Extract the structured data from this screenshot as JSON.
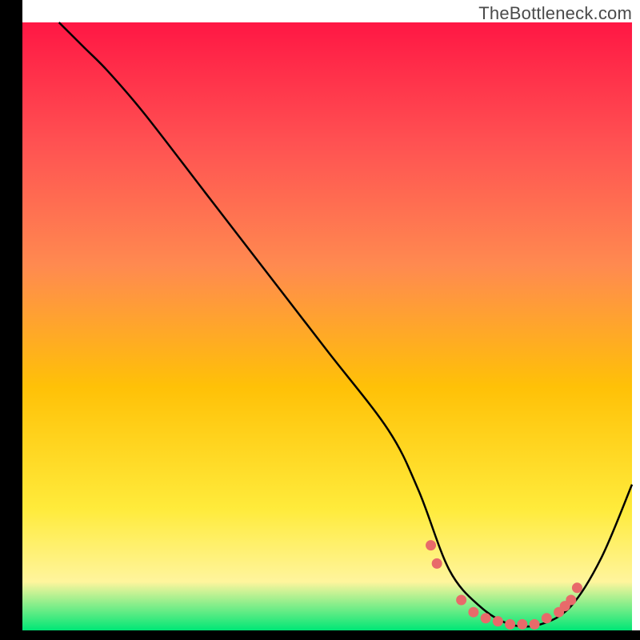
{
  "watermark": "TheBottleneck.com",
  "chart_data": {
    "type": "line",
    "title": "",
    "xlabel": "",
    "ylabel": "",
    "xlim": [
      0,
      100
    ],
    "ylim": [
      0,
      100
    ],
    "series": [
      {
        "name": "bottleneck-curve",
        "x": [
          6,
          10,
          14,
          20,
          30,
          40,
          50,
          60,
          65,
          70,
          75,
          80,
          85,
          90,
          95,
          100
        ],
        "y": [
          100,
          96,
          92,
          85,
          72,
          59,
          46,
          33,
          23,
          10,
          4,
          1,
          1,
          4,
          12,
          24
        ]
      }
    ],
    "markers": {
      "name": "optimal-range-markers",
      "color": "#e86a6a",
      "x": [
        67,
        68,
        72,
        74,
        76,
        78,
        80,
        82,
        84,
        86,
        88,
        89,
        90,
        91
      ],
      "y": [
        14,
        11,
        5,
        3,
        2,
        1.5,
        1,
        1,
        1,
        2,
        3,
        4,
        5,
        7
      ]
    },
    "gradient_stops": [
      {
        "offset": 0,
        "color": "#ff1744"
      },
      {
        "offset": 20,
        "color": "#ff5252"
      },
      {
        "offset": 40,
        "color": "#ff8a50"
      },
      {
        "offset": 60,
        "color": "#ffc107"
      },
      {
        "offset": 80,
        "color": "#ffeb3b"
      },
      {
        "offset": 92,
        "color": "#fff59d"
      },
      {
        "offset": 100,
        "color": "#00e676"
      }
    ],
    "axis_color": "#000000",
    "curve_color": "#000000"
  }
}
